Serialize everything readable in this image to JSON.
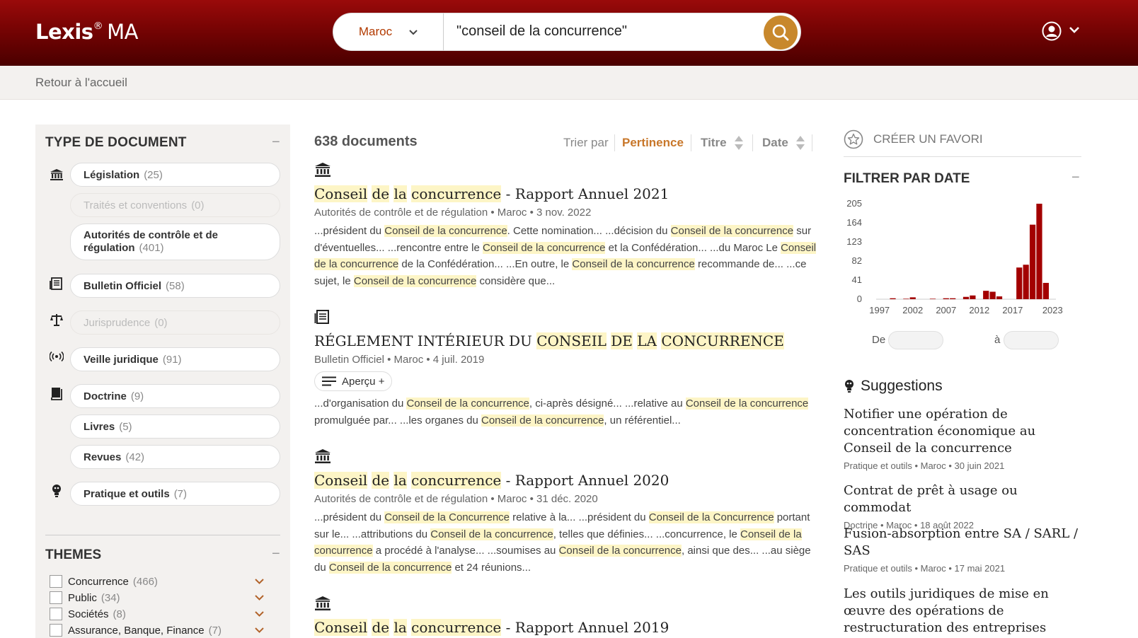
{
  "app": {
    "logo_bold": "Lexis",
    "logo_reg": "®",
    "logo_suffix": "MA"
  },
  "search": {
    "country": "Maroc",
    "query": "\"conseil de la concurrence\""
  },
  "breadcrumb": "Retour à l'accueil",
  "doc_types": {
    "heading": "TYPE DE DOCUMENT",
    "items": [
      {
        "label": "Législation",
        "count": "(25)"
      },
      {
        "label": "Traités et conventions",
        "count": "(0)"
      },
      {
        "label": "Autorités de contrôle et de régulation",
        "count": "(401)"
      },
      {
        "label": "Bulletin Officiel",
        "count": "(58)"
      },
      {
        "label": "Jurisprudence",
        "count": "(0)"
      },
      {
        "label": "Veille juridique",
        "count": "(91)"
      },
      {
        "label": "Doctrine",
        "count": "(9)"
      },
      {
        "label": "Livres",
        "count": "(5)"
      },
      {
        "label": "Revues",
        "count": "(42)"
      },
      {
        "label": "Pratique et outils",
        "count": "(7)"
      }
    ]
  },
  "themes": {
    "heading": "THEMES",
    "items": [
      {
        "label": "Concurrence",
        "count": "(466)"
      },
      {
        "label": "Public",
        "count": "(34)"
      },
      {
        "label": "Sociétés",
        "count": "(8)"
      },
      {
        "label": "Assurance, Banque, Finance",
        "count": "(7)"
      }
    ]
  },
  "results": {
    "count": "638 documents",
    "sort_label": "Trier par",
    "sort_pertinence": "Pertinence",
    "sort_titre": "Titre",
    "sort_date": "Date",
    "apercu": "Aperçu +",
    "items": [
      {
        "title_hl1": "Conseil",
        "title_hl2": "de",
        "title_hl3": "la",
        "title_hl4": "concurrence",
        "title_rest": " - Rapport Annuel 2021",
        "meta": "Autorités de contrôle et de régulation • Maroc • 3 nov. 2022",
        "snippet": "...président du Conseil de la concurrence. Cette nomination...  ...décision du Conseil de la concurrence sur d'éventuelles...  ...rencontre entre le Conseil de la concurrence et la Confédération...  ...du Maroc Le Conseil de la concurrence de la Confédération...  ...En outre, le Conseil de la concurrence recommande de...  ...ce sujet, le Conseil de la concurrence considère que..."
      },
      {
        "title_pre": "RÉGLEMENT INTÉRIEUR DU ",
        "title_hl1": "CONSEIL",
        "title_hl2": "DE",
        "title_hl3": "LA",
        "title_hl4": "CONCURRENCE",
        "meta": "Bulletin Officiel • Maroc • 4 juil. 2019",
        "snippet": "...d'organisation du Conseil de la concurrence, ci-après désigné...  ...relative au Conseil de la concurrence promulguée par...  ...les organes du Conseil de la concurrence, un référentiel..."
      },
      {
        "title_hl1": "Conseil",
        "title_hl2": "de",
        "title_hl3": "la",
        "title_hl4": "concurrence",
        "title_rest": " - Rapport Annuel 2020",
        "meta": "Autorités de contrôle et de régulation • Maroc • 31 déc. 2020",
        "snippet": "...président du Conseil de la Concurrence relative à la...  ...président du Conseil de la Concurrence portant sur le...  ...attributions du Conseil de la concurrence, telles que définies...  ...concurrence, le Conseil de la concurrence a procédé à l'analyse...  ...soumises au Conseil de la concurrence, ainsi que des...  ...au siège du Conseil de la concurrence et 24 réunions..."
      },
      {
        "title_hl1": "Conseil",
        "title_hl2": "de",
        "title_hl3": "la",
        "title_hl4": "concurrence",
        "title_rest": " - Rapport Annuel 2019"
      }
    ]
  },
  "favorite": "CRÉER UN FAVORI",
  "date_filter": {
    "heading": "FILTRER PAR DATE",
    "from_label": "De",
    "to_label": "à"
  },
  "chart_data": {
    "type": "bar",
    "ylim": [
      0,
      205
    ],
    "yticks": [
      "205",
      "164",
      "123",
      "82",
      "41",
      "0"
    ],
    "xticks": [
      "1997",
      "2002",
      "2007",
      "2012",
      "2017",
      "2023"
    ],
    "x": [
      1997,
      1998,
      1999,
      2000,
      2001,
      2002,
      2003,
      2004,
      2005,
      2006,
      2007,
      2008,
      2009,
      2010,
      2011,
      2012,
      2013,
      2014,
      2015,
      2016,
      2017,
      2018,
      2019,
      2020,
      2021,
      2022,
      2023
    ],
    "values": [
      0,
      0,
      2,
      0,
      1,
      4,
      0,
      0,
      1,
      0,
      2,
      2,
      0,
      5,
      8,
      0,
      18,
      16,
      6,
      0,
      0,
      68,
      74,
      160,
      205,
      35,
      0
    ],
    "color": "#a30000"
  },
  "suggestions": {
    "heading": "Suggestions",
    "items": [
      {
        "title": "Notifier une opération de concentration économique au Conseil de la concurrence",
        "meta": "Pratique et outils • Maroc • 30 juin 2021"
      },
      {
        "title": "Contrat de prêt à usage ou commodat",
        "meta": "Doctrine • Maroc • 18 août 2022"
      },
      {
        "title": "Fusion-absorption entre SA / SARL / SAS",
        "meta": "Pratique et outils • Maroc • 17 mai 2021"
      },
      {
        "title": "Les outils juridiques de mise en œuvre des opérations de restructuration des entreprises",
        "meta": ""
      }
    ]
  }
}
